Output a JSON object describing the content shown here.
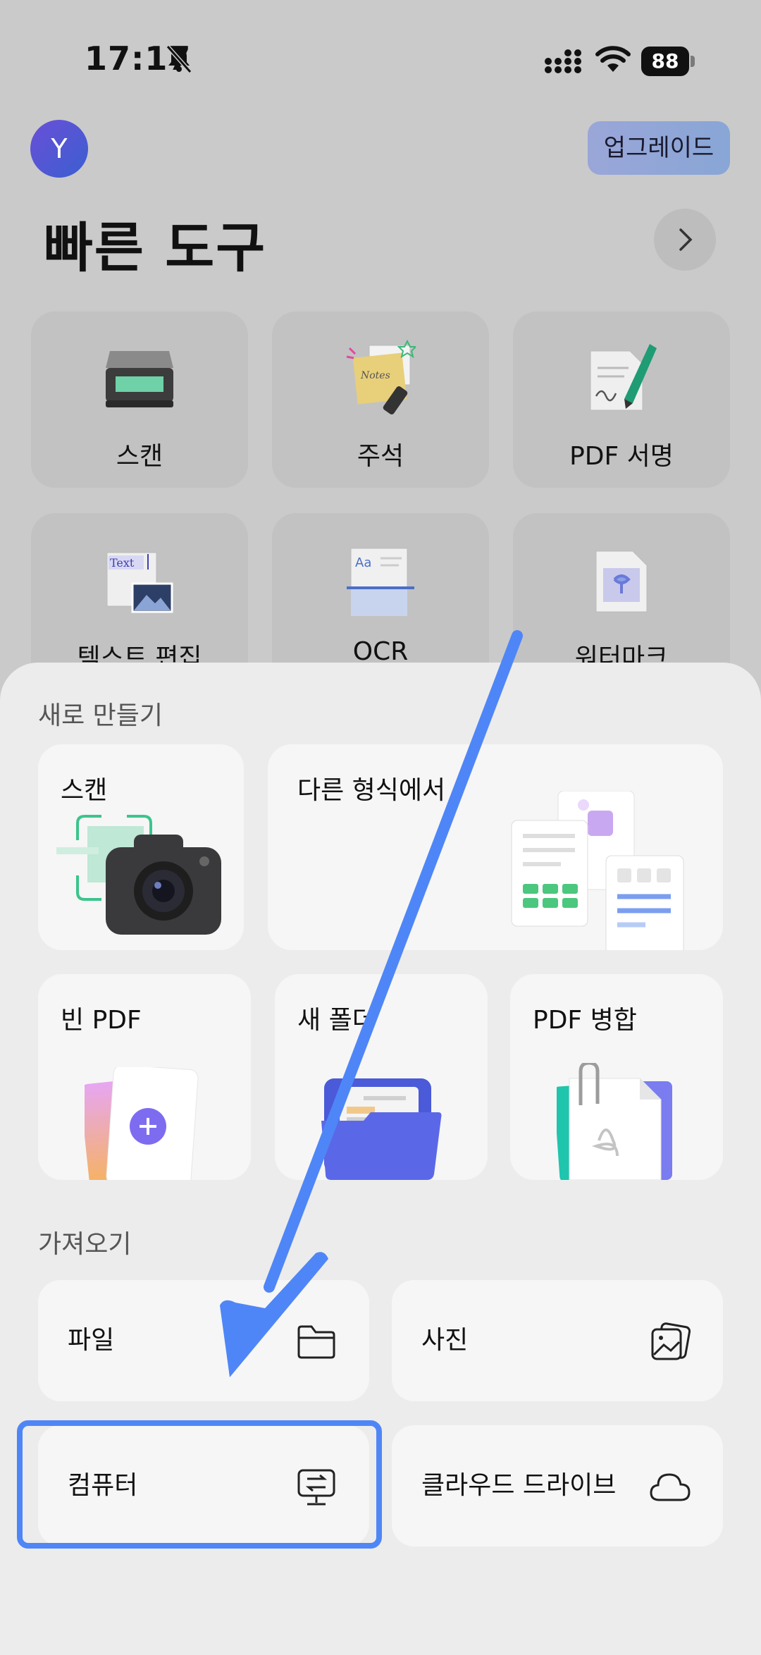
{
  "status_bar": {
    "time": "17:17",
    "battery": "88"
  },
  "header": {
    "avatar_initial": "Y",
    "upgrade_label": "업그레이드",
    "title": "빠른 도구"
  },
  "quick_tools": [
    {
      "label": "스캔",
      "icon": "scanner-icon"
    },
    {
      "label": "주석",
      "icon": "notes-annotation-icon"
    },
    {
      "label": "PDF 서명",
      "icon": "pdf-sign-icon"
    },
    {
      "label": "텍스트 편집",
      "icon": "text-edit-icon",
      "text_badge": "Text"
    },
    {
      "label": "OCR",
      "icon": "ocr-icon",
      "text_badge": "Aa"
    },
    {
      "label": "워터마크",
      "icon": "watermark-icon"
    }
  ],
  "sheet": {
    "new_section_title": "새로 만들기",
    "new_items": {
      "scan": "스캔",
      "from_other_format": "다른 형식에서",
      "blank_pdf": "빈 PDF",
      "new_folder": "새 폴더",
      "merge_pdf": "PDF 병합"
    },
    "import_section_title": "가져오기",
    "import_items": [
      {
        "label": "파일",
        "icon": "folder-icon"
      },
      {
        "label": "사진",
        "icon": "photos-icon"
      },
      {
        "label": "컴퓨터",
        "icon": "computer-transfer-icon"
      },
      {
        "label": "클라우드 드라이브",
        "icon": "cloud-icon"
      }
    ]
  },
  "annotation": {
    "highlighted_item": "컴퓨터",
    "highlight_color": "#4f86f7",
    "arrow_color": "#4f86f7"
  }
}
